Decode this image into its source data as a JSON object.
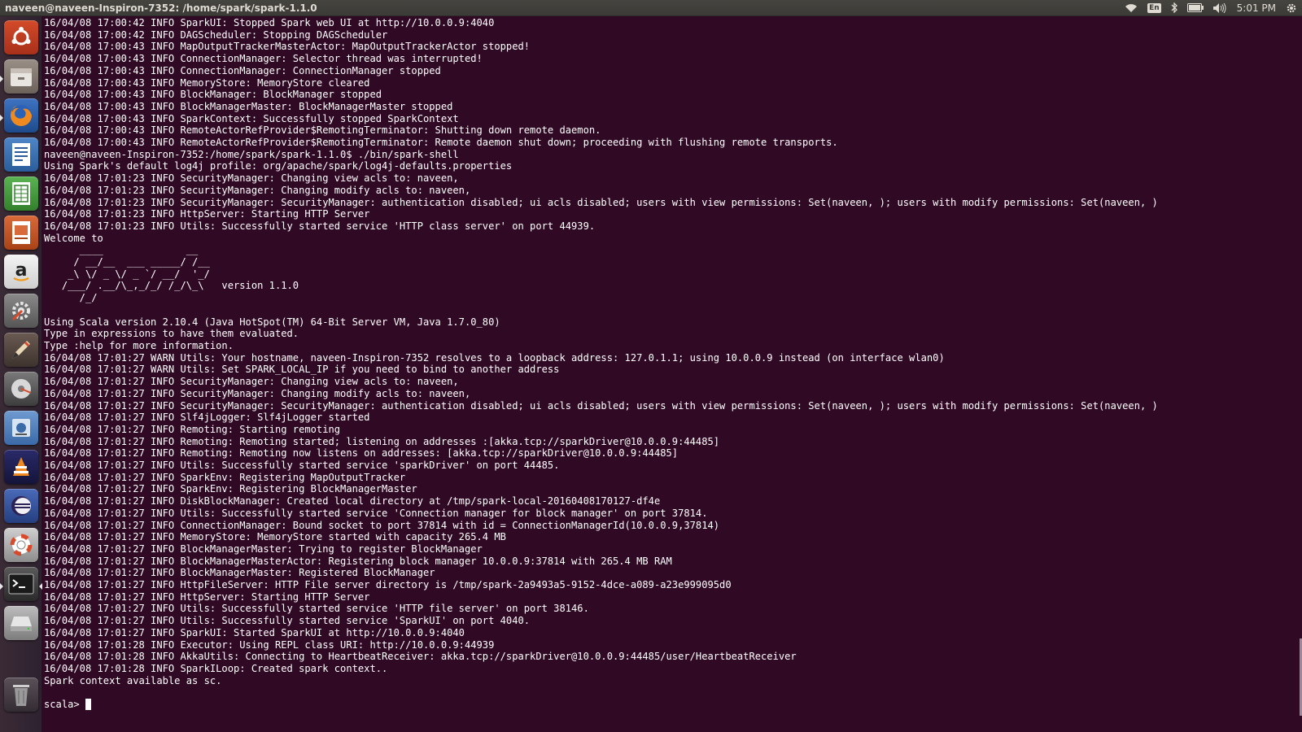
{
  "topbar": {
    "window_title": "naveen@naveen-Inspiron-7352: /home/spark/spark-1.1.0",
    "keyboard_layout": "En",
    "clock": "5:01 PM",
    "icons": [
      "wifi-icon",
      "keyboard-layout-indicator",
      "bluetooth-icon",
      "battery-icon",
      "volume-icon",
      "gear-icon"
    ]
  },
  "launcher": {
    "items": [
      {
        "name": "dash-home-icon",
        "label": "Search your computer"
      },
      {
        "name": "files-icon",
        "label": "Files"
      },
      {
        "name": "firefox-icon",
        "label": "Firefox Web Browser"
      },
      {
        "name": "writer-icon",
        "label": "LibreOffice Writer"
      },
      {
        "name": "calc-icon",
        "label": "LibreOffice Calc"
      },
      {
        "name": "impress-icon",
        "label": "LibreOffice Impress"
      },
      {
        "name": "amazon-icon",
        "label": "Amazon"
      },
      {
        "name": "system-settings-icon",
        "label": "System Settings"
      },
      {
        "name": "text-editor-icon",
        "label": "Text Editor"
      },
      {
        "name": "disk-icon",
        "label": "Disks"
      },
      {
        "name": "software-center-icon",
        "label": "Software"
      },
      {
        "name": "vlc-icon",
        "label": "VLC"
      },
      {
        "name": "eclipse-icon",
        "label": "Eclipse"
      },
      {
        "name": "help-icon",
        "label": "Help"
      },
      {
        "name": "terminal-icon",
        "label": "Terminal"
      },
      {
        "name": "drive-icon",
        "label": "Drive"
      },
      {
        "name": "trash-icon",
        "label": "Trash"
      }
    ]
  },
  "terminal": {
    "lines": [
      "16/04/08 17:00:42 INFO SparkUI: Stopped Spark web UI at http://10.0.0.9:4040",
      "16/04/08 17:00:42 INFO DAGScheduler: Stopping DAGScheduler",
      "16/04/08 17:00:43 INFO MapOutputTrackerMasterActor: MapOutputTrackerActor stopped!",
      "16/04/08 17:00:43 INFO ConnectionManager: Selector thread was interrupted!",
      "16/04/08 17:00:43 INFO ConnectionManager: ConnectionManager stopped",
      "16/04/08 17:00:43 INFO MemoryStore: MemoryStore cleared",
      "16/04/08 17:00:43 INFO BlockManager: BlockManager stopped",
      "16/04/08 17:00:43 INFO BlockManagerMaster: BlockManagerMaster stopped",
      "16/04/08 17:00:43 INFO SparkContext: Successfully stopped SparkContext",
      "16/04/08 17:00:43 INFO RemoteActorRefProvider$RemotingTerminator: Shutting down remote daemon.",
      "16/04/08 17:00:43 INFO RemoteActorRefProvider$RemotingTerminator: Remote daemon shut down; proceeding with flushing remote transports.",
      "naveen@naveen-Inspiron-7352:/home/spark/spark-1.1.0$ ./bin/spark-shell",
      "Using Spark's default log4j profile: org/apache/spark/log4j-defaults.properties",
      "16/04/08 17:01:23 INFO SecurityManager: Changing view acls to: naveen,",
      "16/04/08 17:01:23 INFO SecurityManager: Changing modify acls to: naveen,",
      "16/04/08 17:01:23 INFO SecurityManager: SecurityManager: authentication disabled; ui acls disabled; users with view permissions: Set(naveen, ); users with modify permissions: Set(naveen, )",
      "16/04/08 17:01:23 INFO HttpServer: Starting HTTP Server",
      "16/04/08 17:01:23 INFO Utils: Successfully started service 'HTTP class server' on port 44939.",
      "Welcome to",
      "      ____              __",
      "     / __/__  ___ _____/ /__",
      "    _\\ \\/ _ \\/ _ `/ __/  '_/",
      "   /___/ .__/\\_,_/_/ /_/\\_\\   version 1.1.0",
      "      /_/",
      "",
      "Using Scala version 2.10.4 (Java HotSpot(TM) 64-Bit Server VM, Java 1.7.0_80)",
      "Type in expressions to have them evaluated.",
      "Type :help for more information.",
      "16/04/08 17:01:27 WARN Utils: Your hostname, naveen-Inspiron-7352 resolves to a loopback address: 127.0.1.1; using 10.0.0.9 instead (on interface wlan0)",
      "16/04/08 17:01:27 WARN Utils: Set SPARK_LOCAL_IP if you need to bind to another address",
      "16/04/08 17:01:27 INFO SecurityManager: Changing view acls to: naveen,",
      "16/04/08 17:01:27 INFO SecurityManager: Changing modify acls to: naveen,",
      "16/04/08 17:01:27 INFO SecurityManager: SecurityManager: authentication disabled; ui acls disabled; users with view permissions: Set(naveen, ); users with modify permissions: Set(naveen, )",
      "16/04/08 17:01:27 INFO Slf4jLogger: Slf4jLogger started",
      "16/04/08 17:01:27 INFO Remoting: Starting remoting",
      "16/04/08 17:01:27 INFO Remoting: Remoting started; listening on addresses :[akka.tcp://sparkDriver@10.0.0.9:44485]",
      "16/04/08 17:01:27 INFO Remoting: Remoting now listens on addresses: [akka.tcp://sparkDriver@10.0.0.9:44485]",
      "16/04/08 17:01:27 INFO Utils: Successfully started service 'sparkDriver' on port 44485.",
      "16/04/08 17:01:27 INFO SparkEnv: Registering MapOutputTracker",
      "16/04/08 17:01:27 INFO SparkEnv: Registering BlockManagerMaster",
      "16/04/08 17:01:27 INFO DiskBlockManager: Created local directory at /tmp/spark-local-20160408170127-df4e",
      "16/04/08 17:01:27 INFO Utils: Successfully started service 'Connection manager for block manager' on port 37814.",
      "16/04/08 17:01:27 INFO ConnectionManager: Bound socket to port 37814 with id = ConnectionManagerId(10.0.0.9,37814)",
      "16/04/08 17:01:27 INFO MemoryStore: MemoryStore started with capacity 265.4 MB",
      "16/04/08 17:01:27 INFO BlockManagerMaster: Trying to register BlockManager",
      "16/04/08 17:01:27 INFO BlockManagerMasterActor: Registering block manager 10.0.0.9:37814 with 265.4 MB RAM",
      "16/04/08 17:01:27 INFO BlockManagerMaster: Registered BlockManager",
      "16/04/08 17:01:27 INFO HttpFileServer: HTTP File server directory is /tmp/spark-2a9493a5-9152-4dce-a089-a23e999095d0",
      "16/04/08 17:01:27 INFO HttpServer: Starting HTTP Server",
      "16/04/08 17:01:27 INFO Utils: Successfully started service 'HTTP file server' on port 38146.",
      "16/04/08 17:01:27 INFO Utils: Successfully started service 'SparkUI' on port 4040.",
      "16/04/08 17:01:27 INFO SparkUI: Started SparkUI at http://10.0.0.9:4040",
      "16/04/08 17:01:28 INFO Executor: Using REPL class URI: http://10.0.0.9:44939",
      "16/04/08 17:01:28 INFO AkkaUtils: Connecting to HeartbeatReceiver: akka.tcp://sparkDriver@10.0.0.9:44485/user/HeartbeatReceiver",
      "16/04/08 17:01:28 INFO SparkILoop: Created spark context..",
      "Spark context available as sc."
    ],
    "prompt": "scala>"
  },
  "colors": {
    "terminal_bg": "#300a24",
    "terminal_fg": "#ffffff",
    "panel_bg": "#3c3b37",
    "launcher_bg": "#3a2a35"
  }
}
